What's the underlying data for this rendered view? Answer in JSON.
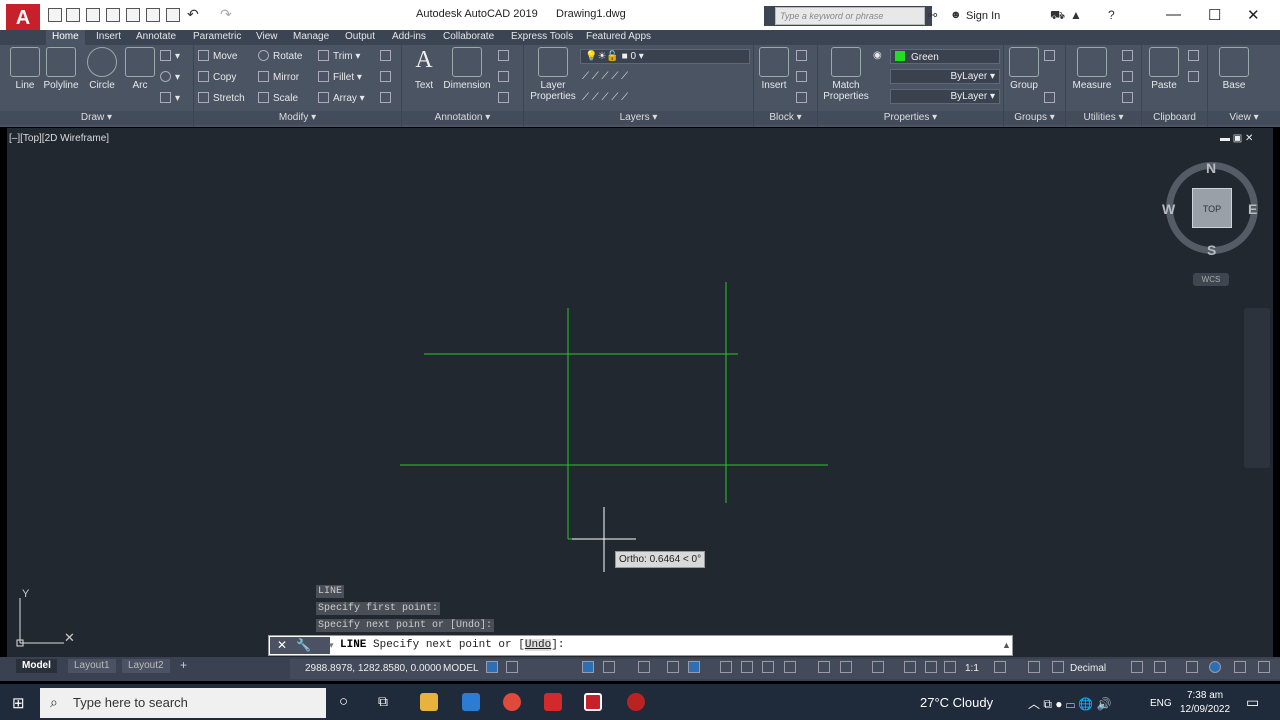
{
  "title": {
    "app": "Autodesk AutoCAD 2019",
    "file": "Drawing1.dwg",
    "search_placeholder": "Type a keyword or phrase",
    "signin": "Sign In"
  },
  "tabs": [
    "Home",
    "Insert",
    "Annotate",
    "Parametric",
    "View",
    "Manage",
    "Output",
    "Add-ins",
    "Collaborate",
    "Express Tools",
    "Featured Apps"
  ],
  "ribbon": {
    "draw": {
      "label": "Draw",
      "tools": [
        "Line",
        "Polyline",
        "Circle",
        "Arc"
      ]
    },
    "modify": {
      "label": "Modify",
      "tools": [
        "Move",
        "Rotate",
        "Trim",
        "Copy",
        "Mirror",
        "Fillet",
        "Stretch",
        "Scale",
        "Array"
      ]
    },
    "annotation": {
      "label": "Annotation",
      "tools": [
        "Text",
        "Dimension"
      ]
    },
    "layers": {
      "label": "Layers",
      "tool": "Layer Properties",
      "current_layer": "0"
    },
    "block": {
      "label": "Block",
      "tool": "Insert"
    },
    "properties": {
      "label": "Properties",
      "tool": "Match Properties",
      "color": "Green",
      "linetype": "ByLayer",
      "lineweight": "ByLayer"
    },
    "groups": {
      "label": "Groups",
      "tool": "Group"
    },
    "utilities": {
      "label": "Utilities",
      "tool": "Measure"
    },
    "clipboard": {
      "label": "Clipboard",
      "tool": "Paste"
    },
    "view": {
      "label": "View",
      "tool": "Base"
    }
  },
  "viewport": {
    "label": "[–][Top][2D Wireframe]",
    "cube_top": "TOP",
    "compass": {
      "n": "N",
      "s": "S",
      "e": "E",
      "w": "W"
    },
    "wcs": "WCS",
    "ucs_y": "Y",
    "line_color": "#22cc22"
  },
  "tooltip": "Ortho: 0.6464 < 0°",
  "history": [
    "LINE",
    "Specify first point:",
    "Specify next point or [Undo]:"
  ],
  "command": {
    "name": "LINE",
    "prompt": " Specify next point or [",
    "option": "Undo",
    "end": "]:"
  },
  "layout_tabs": [
    "Model",
    "Layout1",
    "Layout2"
  ],
  "status": {
    "coords": "2988.8978, 1282.8580, 0.0000",
    "model": "MODEL",
    "scale": "1:1",
    "units": "Decimal"
  },
  "taskbar": {
    "search": "Type here to search",
    "weather": "27°C  Cloudy",
    "lang": "ENG",
    "time": "7:38 am",
    "date": "12/09/2022"
  }
}
